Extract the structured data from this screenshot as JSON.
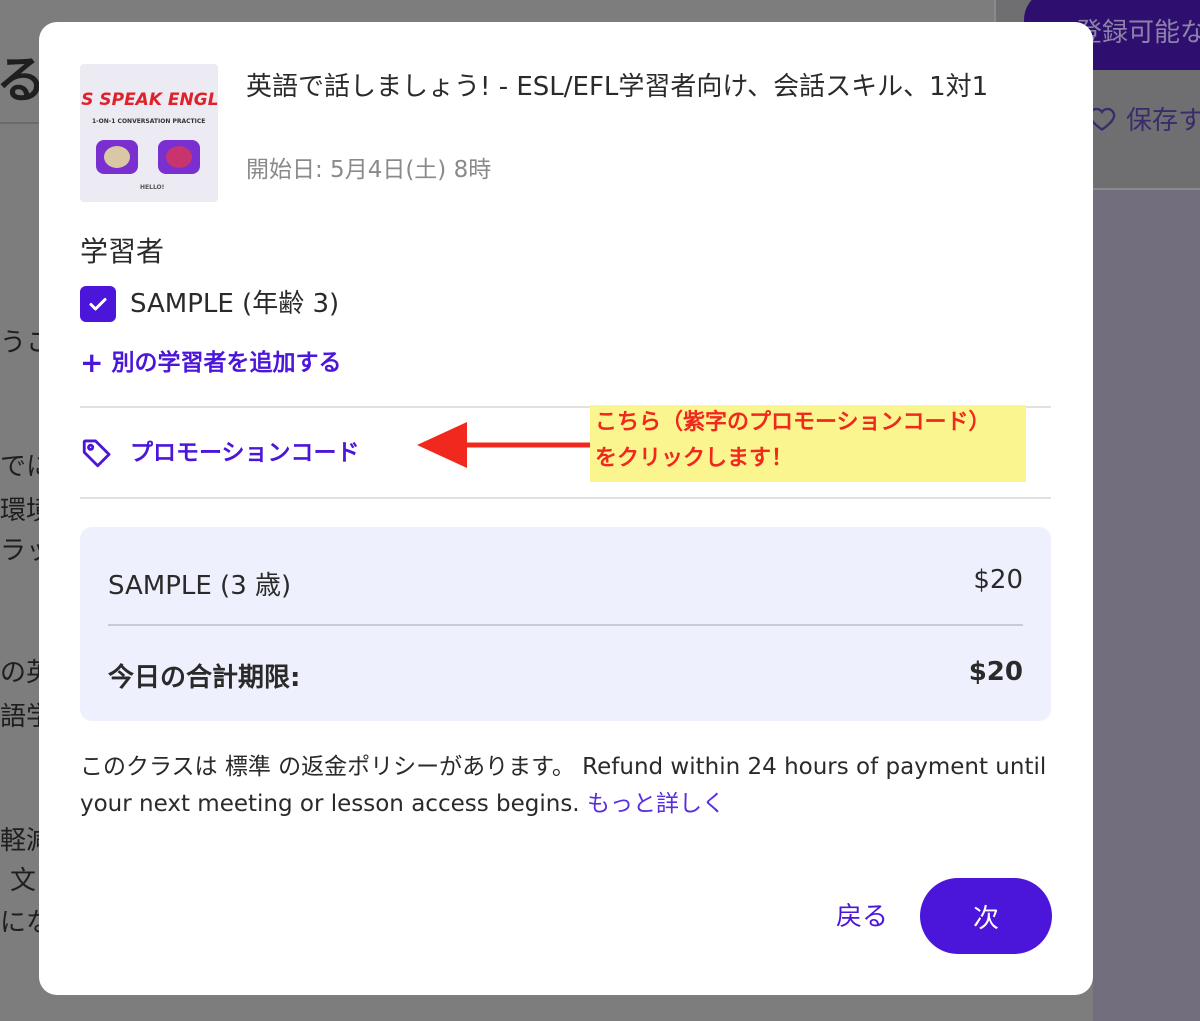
{
  "background": {
    "register_button_fragment": "登録可能な",
    "save_fragment": "保存す",
    "title_fragment": "る",
    "text_fragments": [
      "うこ",
      "でに",
      "環境",
      "ラッ",
      "の英",
      "語学",
      "軽減",
      "文",
      "にな"
    ]
  },
  "course": {
    "thumbnail_title": "'S SPEAK ENGLI",
    "thumbnail_subtitle": "1-ON-1 CONVERSATION PRACTICE",
    "thumbnail_hello": "HELLO!",
    "title": "英語で話しましょう! - ESL/EFL学習者向け、会話スキル、1対1",
    "start_date": "開始日: 5月4日(土) 8時"
  },
  "learners": {
    "heading": "学習者",
    "selected_learner": "SAMPLE (年齢 3)",
    "add_learner_label": "別の学習者を追加する"
  },
  "promo": {
    "label": "プロモーションコード"
  },
  "annotation": {
    "line1": "こちら（紫字のプロモーションコード）",
    "line2": "をクリックします！"
  },
  "summary": {
    "item_label": "SAMPLE (3 歳)",
    "item_price": "$20",
    "total_label": "今日の合計期限:",
    "total_price": "$20"
  },
  "refund": {
    "text": "このクラスは 標準 の返金ポリシーがあります。 Refund within 24 hours of payment until your next meeting or lesson access begins.",
    "more_link": "もっと詳しく"
  },
  "actions": {
    "back_label": "戻る",
    "next_label": "次"
  },
  "colors": {
    "accent": "#4b16d9",
    "annotation_bg": "#fbf58f",
    "annotation_text": "#f0281e",
    "summary_bg": "#eef0fd"
  }
}
